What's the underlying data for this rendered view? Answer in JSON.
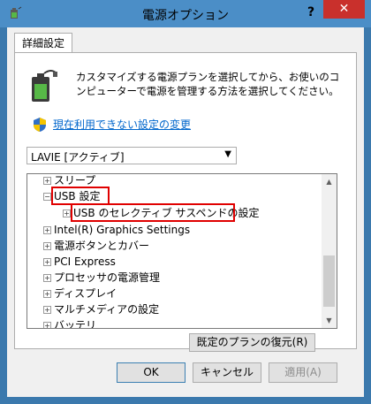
{
  "window": {
    "title": "電源オプション",
    "help": "?",
    "close": "✕"
  },
  "tab": {
    "label": "詳細設定"
  },
  "description": "カスタマイズする電源プランを選択してから、お使いのコンピューターで電源を管理する方法を選択してください。",
  "link": {
    "label": "現在利用できない設定の変更"
  },
  "plan_select": {
    "value": "LAVIE [アクティブ]"
  },
  "tree": {
    "items": [
      {
        "label": "スリープ",
        "expander": "+"
      },
      {
        "label": "USB 設定",
        "expander": "−"
      },
      {
        "label": "USB のセレクティブ サスペンドの設定",
        "expander": "+"
      },
      {
        "label": "Intel(R) Graphics Settings",
        "expander": "+"
      },
      {
        "label": "電源ボタンとカバー",
        "expander": "+"
      },
      {
        "label": "PCI Express",
        "expander": "+"
      },
      {
        "label": "プロセッサの電源管理",
        "expander": "+"
      },
      {
        "label": "ディスプレイ",
        "expander": "+"
      },
      {
        "label": "マルチメディアの設定",
        "expander": "+"
      },
      {
        "label": "バッテリ",
        "expander": "+"
      }
    ]
  },
  "buttons": {
    "restore": "既定のプランの復元(R)",
    "ok": "OK",
    "cancel": "キャンセル",
    "apply": "適用(A)"
  },
  "colors": {
    "highlight": "#e00000",
    "link": "#0066cc",
    "close": "#c9302c"
  }
}
